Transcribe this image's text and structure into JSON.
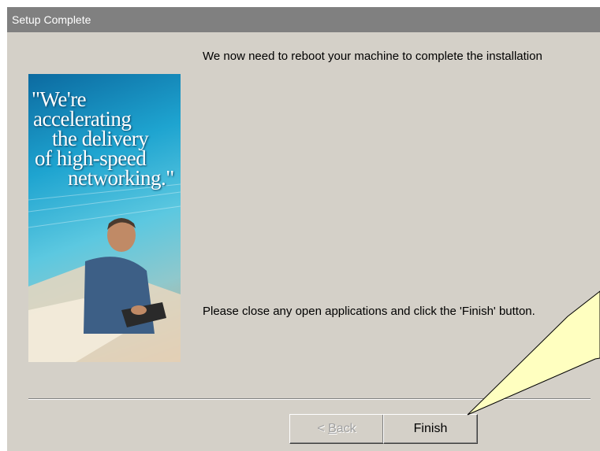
{
  "window": {
    "title": "Setup Complete"
  },
  "banner": {
    "quote_lines": [
      "\"We're",
      "accelerating",
      "the delivery",
      "of high-speed",
      "networking.\""
    ]
  },
  "messages": {
    "reboot": "We now need to reboot your machine to complete the installation",
    "close_apps": "Please close any open applications and click the 'Finish' button."
  },
  "buttons": {
    "back_label": "< Back",
    "finish_label": "Finish",
    "back_enabled": false
  },
  "colors": {
    "titlebar": "#808080",
    "dialog_bg": "#d4d0c8",
    "callout_fill": "#ffffc0"
  }
}
